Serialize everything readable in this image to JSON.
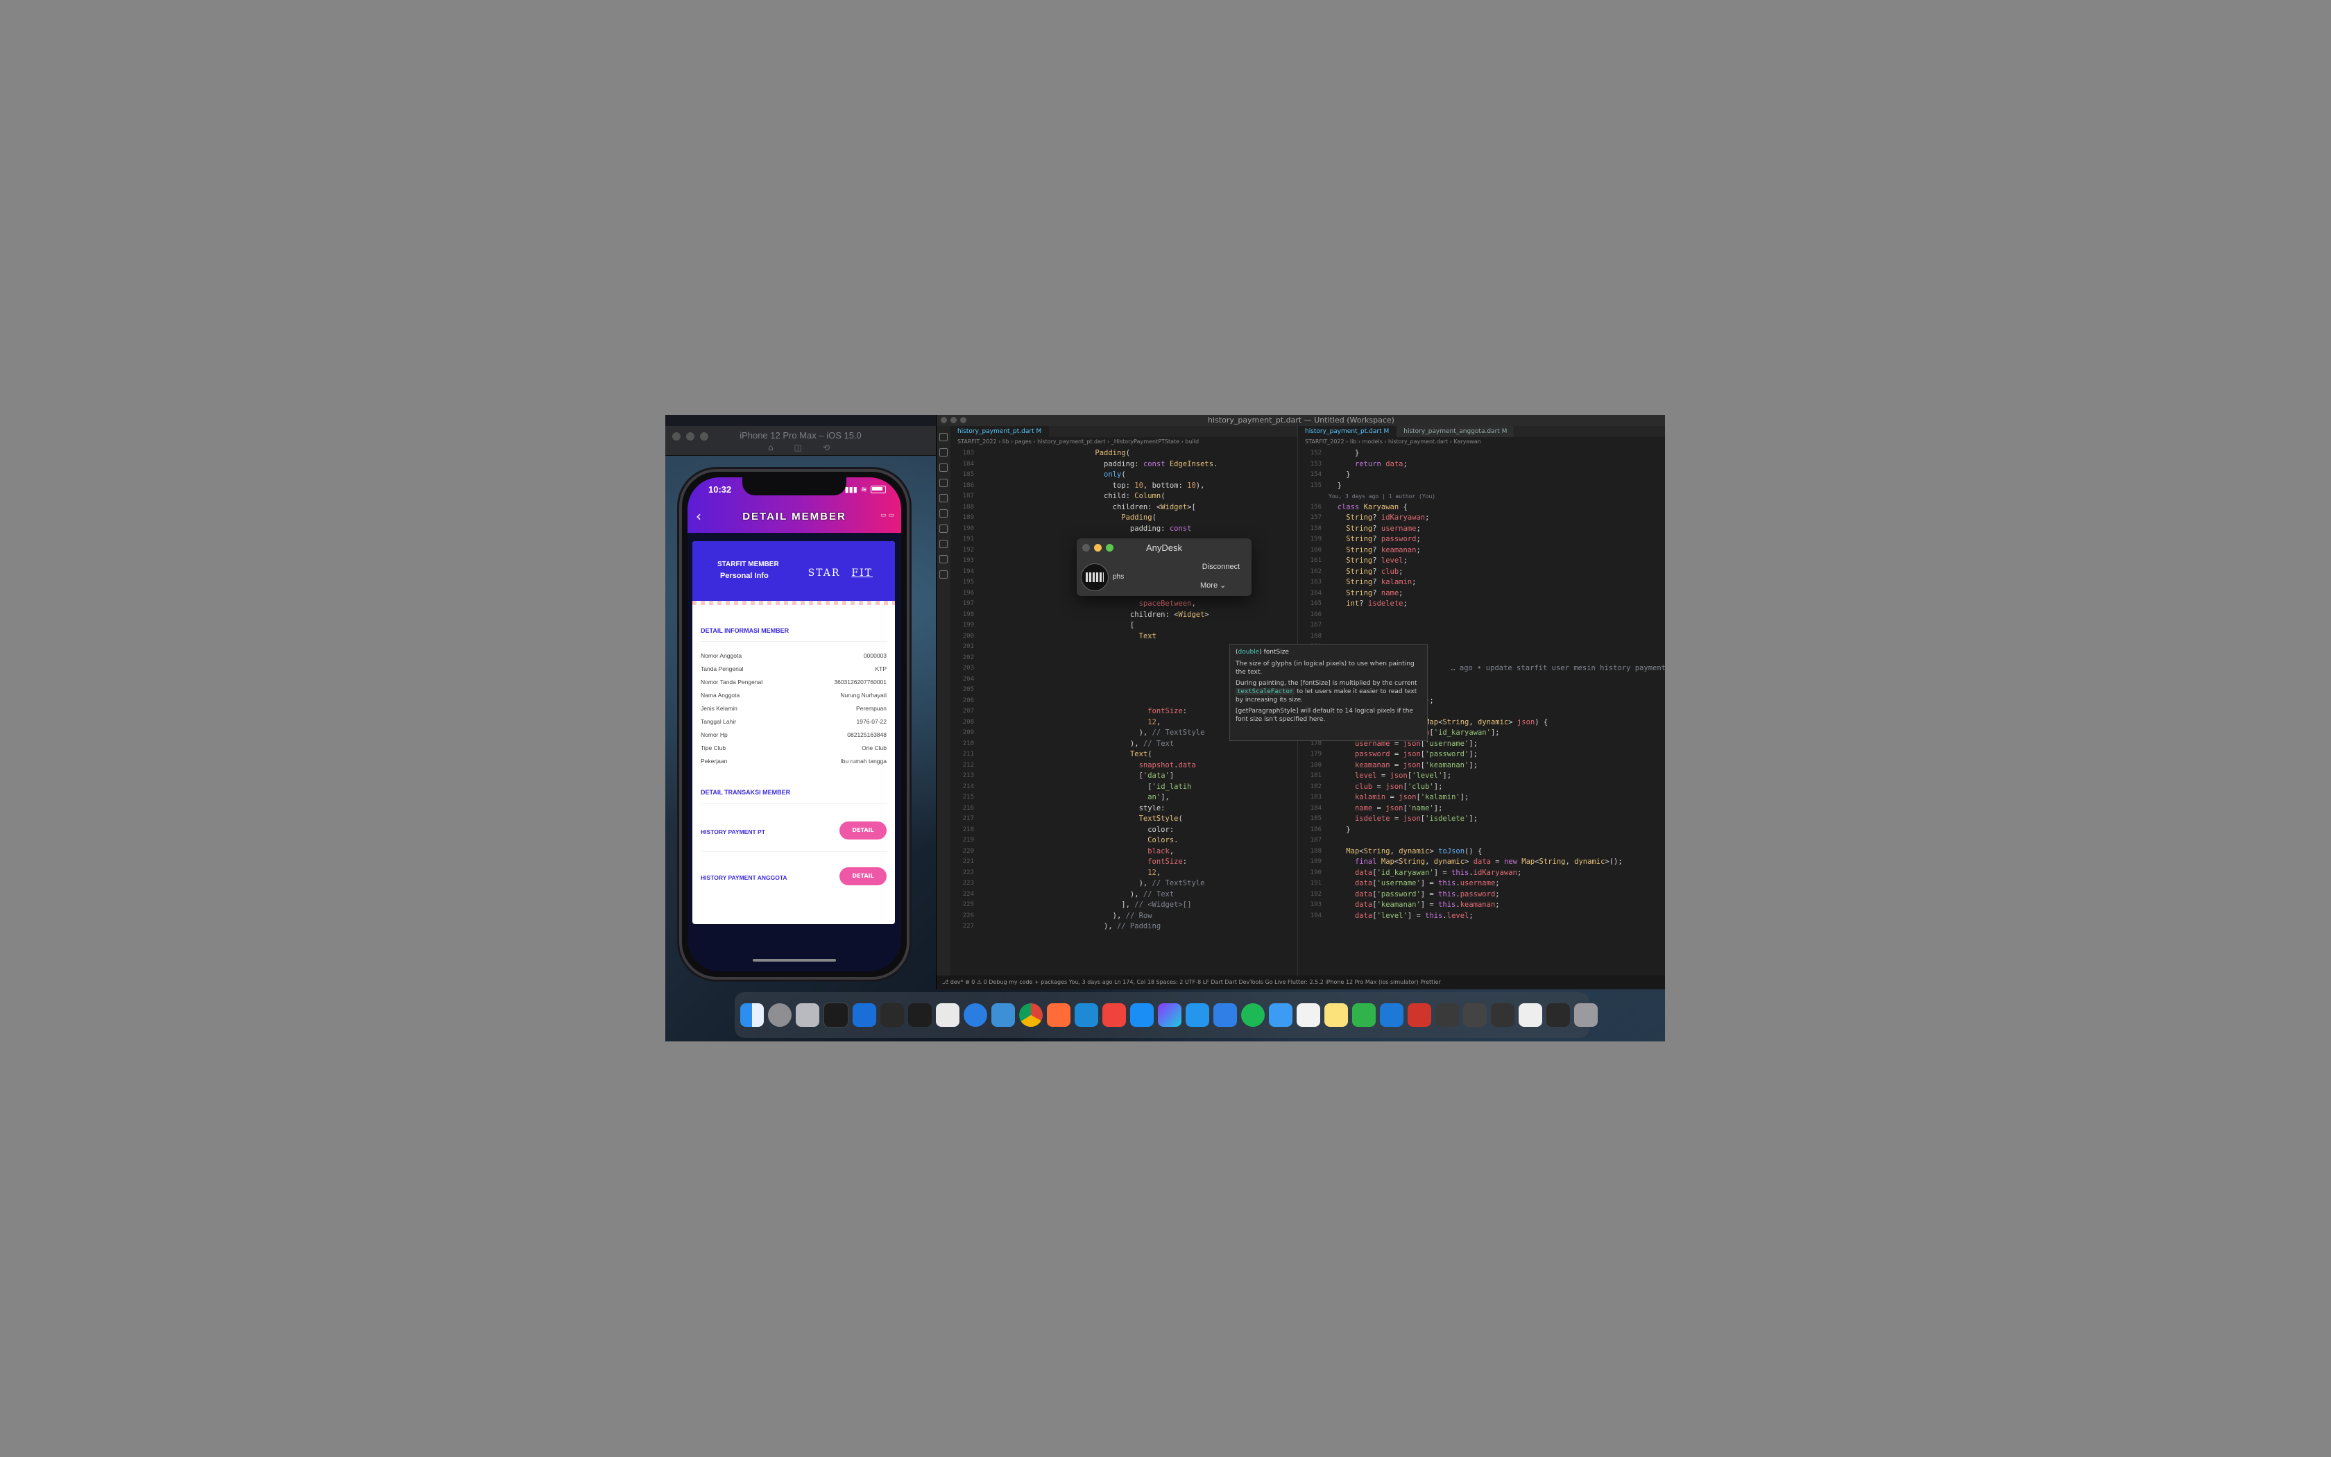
{
  "simulator": {
    "title": "iPhone 12 Pro Max – iOS 15.0",
    "status_time": "10:32",
    "app": {
      "title": "DETAIL MEMBER",
      "card_header": {
        "member_label": "STARFIT MEMBER",
        "subtitle": "Personal Info",
        "logo_star": "STAR",
        "logo_fit": "FIT"
      },
      "section_info": "DETAIL INFORMASI MEMBER",
      "rows": [
        {
          "label": "Nomor Anggota",
          "value": "0000003"
        },
        {
          "label": "Tanda Pengenal",
          "value": "KTP"
        },
        {
          "label": "Nomor Tanda Pengenal",
          "value": "3603126207760001"
        },
        {
          "label": "Nama Anggota",
          "value": "Nurung Nurhayati"
        },
        {
          "label": "Jenis Kelamin",
          "value": "Perempuan"
        },
        {
          "label": "Tanggal Lahir",
          "value": "1976-07-22"
        },
        {
          "label": "Nomor Hp",
          "value": "082125163848"
        },
        {
          "label": "Tipe Club",
          "value": "One Club"
        },
        {
          "label": "Pekerjaan",
          "value": "Ibu rumah tangga"
        }
      ],
      "section_transaksi": "DETAIL TRANSAKSI MEMBER",
      "history_pt": "HISTORY PAYMENT PT",
      "history_anggota": "HISTORY PAYMENT ANGGOTA",
      "detail_button": "DETAIL"
    }
  },
  "vscode": {
    "title": "history_payment_pt.dart — Untitled (Workspace)",
    "left_tab": "history_payment_pt.dart M",
    "right_tabs": [
      "history_payment_pt.dart M",
      "history_payment_anggota.dart M"
    ],
    "left_breadcrumb": "STARFIT_2022 › lib › pages › history_payment_pt.dart › _HistoryPaymentPTState › build",
    "right_breadcrumb": "STARFIT_2022 › lib › models › history_payment.dart › Karyawan",
    "blame": "You, 3 days ago | 1 author (You)",
    "inline_blame": "… ago • update starfit user mesin history payment",
    "statusbar": "⎇ dev*  ⊗ 0 ⚠ 0  Debug my code + packages  You, 3 days ago  Ln 174, Col 18  Spaces: 2  UTF-8  LF  Dart  Dart DevTools  Go Live  Flutter: 2.5.2  iPhone 12 Pro Max (ios simulator)  Prettier",
    "tooltip": {
      "signature_type": "double",
      "signature_name": "fontSize",
      "p1": "The size of glyphs (in logical pixels) to use when painting the text.",
      "p2_pre": "During painting, the [fontSize] is multiplied by the current",
      "p2_code": "textScaleFactor",
      "p2_post": "to let users make it easier to read text by increasing its size.",
      "p3": "[getParagraphStyle] will default to 14 logical pixels if the font size isn't specified here."
    }
  },
  "anydesk": {
    "title": "AnyDesk",
    "user": "phs",
    "disconnect": "Disconnect",
    "more": "More"
  },
  "dock": {
    "icons": [
      "finder-icon",
      "launchpad-icon",
      "system-preferences-icon",
      "terminal-icon",
      "xcode-icon",
      "simulator-icon",
      "figma-icon",
      "tableplus-icon",
      "safari-icon",
      "vscode-alt-icon",
      "chrome-icon",
      "postman-icon",
      "vscode-icon",
      "anydesk-icon",
      "app-store-icon",
      "goland-icon",
      "docker-icon",
      "maps-icon",
      "spotify-icon",
      "mail-icon",
      "calendar-icon",
      "notes-icon",
      "numbers-icon",
      "keynote-icon",
      "preview-icon",
      "window-1-icon",
      "window-2-icon",
      "window-3-icon",
      "window-4-icon",
      "window-5-icon",
      "trash-icon"
    ]
  }
}
